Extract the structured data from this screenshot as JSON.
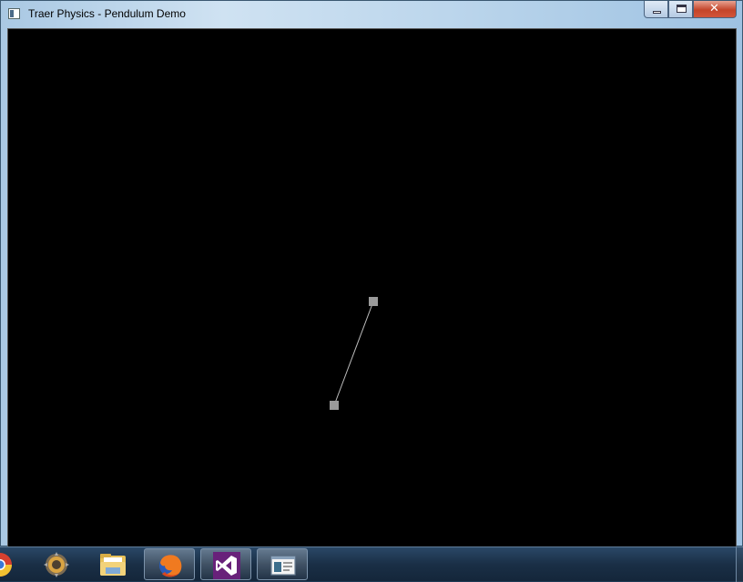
{
  "window": {
    "title": "Traer Physics - Pendulum Demo",
    "controls": [
      "minimize",
      "maximize",
      "close"
    ]
  },
  "canvas": {
    "background": "#000000",
    "particle_color": "#9a9a9a",
    "spring_color": "#bfbfbf"
  },
  "taskbar": {
    "apps": [
      {
        "name": "chrome",
        "icon": "chrome-icon",
        "active": false
      },
      {
        "name": "media-player",
        "icon": "gear-orb-icon",
        "active": false
      },
      {
        "name": "file-explorer",
        "icon": "folder-icon",
        "active": false
      },
      {
        "name": "firefox",
        "icon": "firefox-icon",
        "active": true
      },
      {
        "name": "visual-studio",
        "icon": "visual-studio-icon",
        "active": true
      },
      {
        "name": "pendulum-demo",
        "icon": "window-app-icon",
        "active": true
      }
    ]
  }
}
